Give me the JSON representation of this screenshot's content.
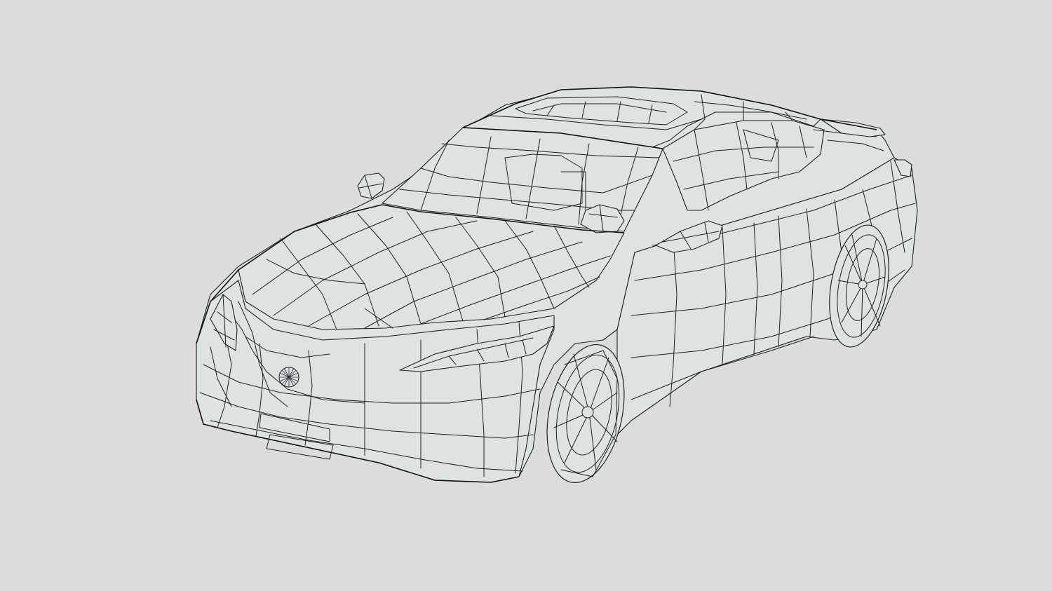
{
  "viewport": {
    "background_color": "#dcdcdc",
    "surface_color": "#dde3e3",
    "wire_color": "#1c1f20",
    "render_mode": "wireframe"
  },
  "model": {
    "subject": "car-wireframe-mesh",
    "parts": [
      "body",
      "hood",
      "windshield",
      "roof",
      "side-mirror-left",
      "side-mirror-right",
      "headlight-left",
      "headlight-right",
      "front-grille",
      "emblem",
      "front-bumper",
      "front-wheel",
      "rear-wheel",
      "rear-spoiler"
    ]
  }
}
